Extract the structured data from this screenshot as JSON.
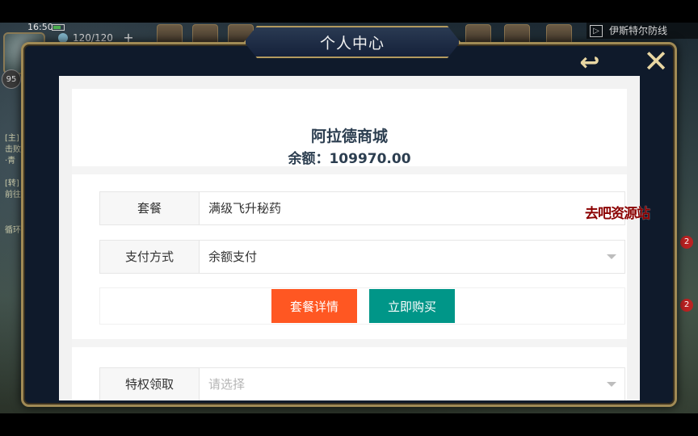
{
  "status_bar": {
    "time": "16:50"
  },
  "hud": {
    "energy": "120/120",
    "level": "95",
    "plus_label": "+",
    "map_name": "伊斯特尔防线",
    "map_icon": "▷",
    "side_badges": [
      "2",
      "2"
    ],
    "left_texts": [
      "[主]",
      "击败",
      "·青",
      "[转]",
      "前往",
      "循环"
    ]
  },
  "modal": {
    "title": "个人中心",
    "back_icon": "back-arrow-icon",
    "close_icon": "close-x-icon"
  },
  "store": {
    "name": "阿拉德商城",
    "balance": "余额：109970.00"
  },
  "form": {
    "package": {
      "label": "套餐",
      "value": "满级飞升秘药"
    },
    "payment": {
      "label": "支付方式",
      "value": "余额支付"
    },
    "privilege": {
      "label": "特权领取",
      "placeholder": "请选择"
    }
  },
  "buttons": {
    "details": "套餐详情",
    "buy": "立即购买"
  },
  "colors": {
    "details_button": "#FF5722",
    "buy_button": "#009688",
    "frame_gold": "#A08A55",
    "title_text": "#2C3E50"
  },
  "watermark": "去吧资源站"
}
